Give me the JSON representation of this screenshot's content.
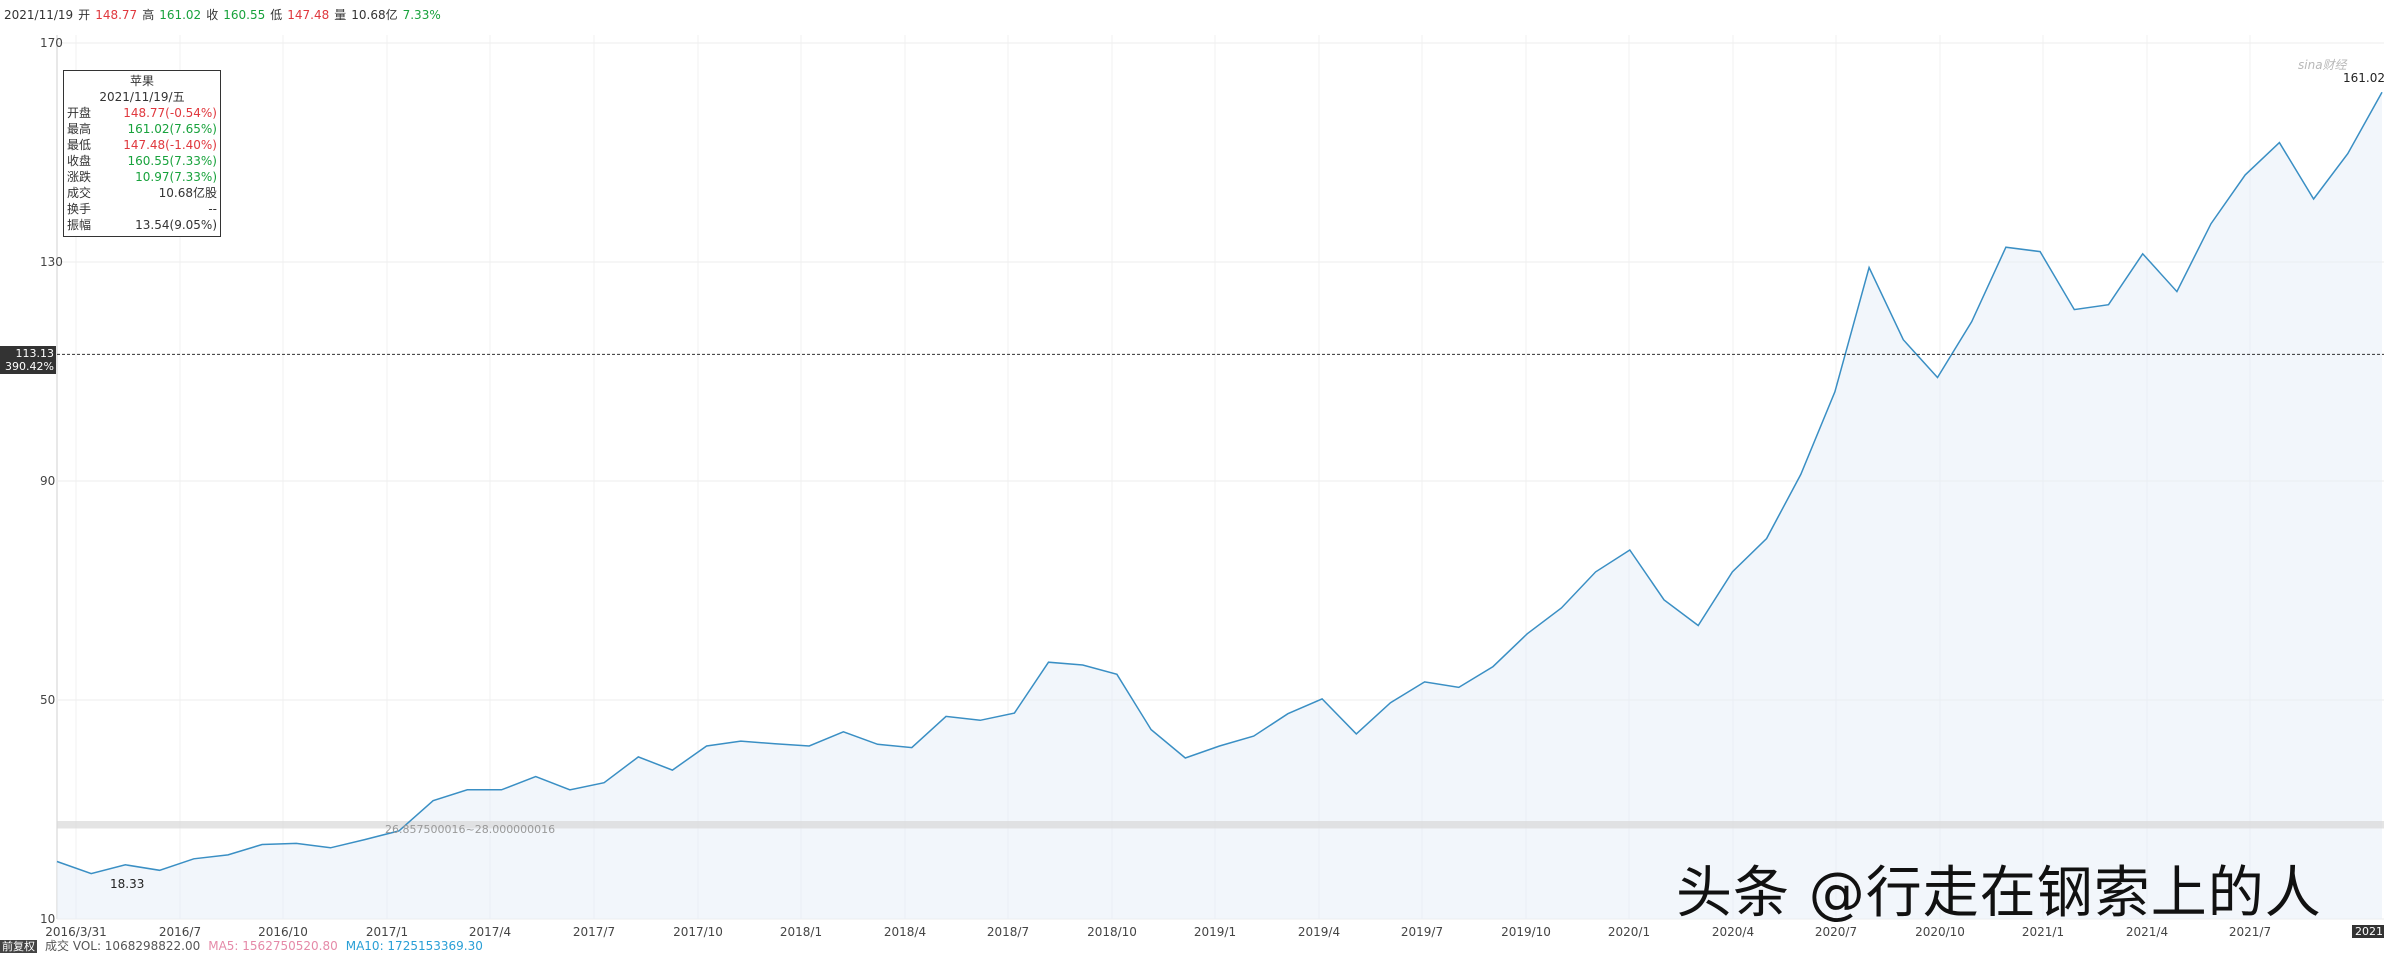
{
  "header": {
    "date": "2021/11/19",
    "open_label": "开",
    "open": "148.77",
    "high_label": "高",
    "high": "161.02",
    "close_label": "收",
    "close": "160.55",
    "low_label": "低",
    "low": "147.48",
    "volume_label": "量",
    "volume": "10.68亿",
    "change_pct": "7.33%"
  },
  "tooltip": {
    "name": "苹果",
    "date": "2021/11/19/五",
    "rows": [
      {
        "label": "开盘",
        "value": "148.77(-0.54%)",
        "color": "red"
      },
      {
        "label": "最高",
        "value": "161.02(7.65%)",
        "color": "green"
      },
      {
        "label": "最低",
        "value": "147.48(-1.40%)",
        "color": "red"
      },
      {
        "label": "收盘",
        "value": "160.55(7.33%)",
        "color": "green"
      },
      {
        "label": "涨跌",
        "value": "10.97(7.33%)",
        "color": "green"
      },
      {
        "label": "成交",
        "value": "10.68亿股",
        "color": "dark"
      },
      {
        "label": "换手",
        "value": "--",
        "color": "dark"
      },
      {
        "label": "振幅",
        "value": "13.54(9.05%)",
        "color": "dark"
      }
    ]
  },
  "crosshair": {
    "price": "113.13",
    "pct": "390.42%"
  },
  "annotations": {
    "last_price": "161.02",
    "min_price": "18.33",
    "range_text": "26.857500016~28.000000016",
    "last_date": "2021",
    "logo_text": "sina财经"
  },
  "bottom_bar": {
    "adj_label": "前复权",
    "vol_text": "成交 VOL: 1068298822.00",
    "ma5_text": "MA5: 1562750520.80",
    "ma10_text": "MA10: 1725153369.30"
  },
  "watermark": "头条 @行走在钢索上的人",
  "colors": {
    "line": "#3a8fc4",
    "fill": "#e8eef8",
    "up": "#18a23c",
    "down": "#e0383e",
    "ma5": "#e58aa8",
    "ma10": "#2a9fd6"
  },
  "chart_data": {
    "type": "area",
    "title": "苹果",
    "ylim": [
      10,
      170
    ],
    "yticks": [
      10,
      50,
      90,
      130,
      170
    ],
    "xticks": [
      "2016/3/31",
      "2016/7",
      "2016/10",
      "2017/1",
      "2017/4",
      "2017/7",
      "2017/10",
      "2018/1",
      "2018/4",
      "2018/7",
      "2018/10",
      "2019/1",
      "2019/4",
      "2019/7",
      "2019/10",
      "2020/1",
      "2020/4",
      "2020/7",
      "2020/10",
      "2021/1",
      "2021/4",
      "2021/7"
    ],
    "grid": true,
    "reference_line": 113.13,
    "series": [
      {
        "name": "苹果",
        "x": [
          "2016/3",
          "2016/4",
          "2016/5",
          "2016/6",
          "2016/7",
          "2016/8",
          "2016/9",
          "2016/10",
          "2016/11",
          "2016/12",
          "2017/1",
          "2017/2",
          "2017/3",
          "2017/4",
          "2017/5",
          "2017/6",
          "2017/7",
          "2017/8",
          "2017/9",
          "2017/10",
          "2017/11",
          "2017/12",
          "2018/1",
          "2018/2",
          "2018/3",
          "2018/4",
          "2018/5",
          "2018/6",
          "2018/7",
          "2018/8",
          "2018/9",
          "2018/10",
          "2018/11",
          "2018/12",
          "2019/1",
          "2019/2",
          "2019/3",
          "2019/4",
          "2019/5",
          "2019/6",
          "2019/7",
          "2019/8",
          "2019/9",
          "2019/10",
          "2019/11",
          "2019/12",
          "2020/1",
          "2020/2",
          "2020/3",
          "2020/4",
          "2020/5",
          "2020/6",
          "2020/7",
          "2020/8",
          "2020/9",
          "2020/10",
          "2020/11",
          "2020/12",
          "2021/1",
          "2021/2",
          "2021/3",
          "2021/4",
          "2021/5",
          "2021/6",
          "2021/7",
          "2021/8",
          "2021/9",
          "2021/10",
          "2021/11"
        ],
        "values": [
          20.5,
          18.3,
          19.9,
          18.9,
          21.0,
          21.7,
          23.6,
          23.8,
          23.0,
          24.5,
          26.1,
          31.6,
          33.6,
          33.6,
          36.0,
          33.6,
          34.9,
          39.6,
          37.2,
          41.6,
          42.5,
          42.0,
          41.6,
          44.2,
          41.9,
          41.3,
          47.0,
          46.3,
          47.6,
          56.9,
          56.4,
          54.7,
          44.6,
          39.4,
          41.6,
          43.4,
          47.5,
          50.2,
          43.8,
          49.5,
          53.3,
          52.3,
          56.1,
          62.1,
          66.8,
          73.4,
          77.4,
          68.3,
          63.6,
          73.4,
          79.5,
          91.2,
          106.3,
          129.0,
          115.8,
          108.9,
          119.1,
          132.7,
          131.9,
          121.3,
          122.2,
          131.5,
          124.6,
          137.0,
          145.9,
          151.8,
          141.5,
          149.8,
          161.0
        ]
      }
    ]
  }
}
